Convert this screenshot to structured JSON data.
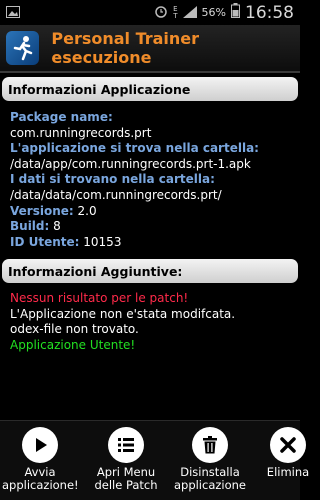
{
  "status_bar": {
    "time": "16:58",
    "battery_percent": "56%",
    "network_label": [
      "E",
      "T"
    ],
    "icons": [
      "image-icon",
      "alarm-icon",
      "network-icon",
      "signal-icon",
      "battery-icon"
    ]
  },
  "app": {
    "title": "Personal Trainer esecuzione",
    "icon": "runner-icon"
  },
  "sections": {
    "app_info": {
      "header": "Informazioni Applicazione",
      "package_label": "Package name:",
      "package_value": "com.runningrecords.prt",
      "location_label": "L'applicazione si trova nella cartella:",
      "location_value": "/data/app/com.runningrecords.prt-1.apk",
      "data_label": "I dati si trovano nella cartella:",
      "data_value": "/data/data/com.runningrecords.prt/",
      "version_label": "Versione:",
      "version_value": "2.0",
      "build_label": "Build:",
      "build_value": "8",
      "uid_label": "ID Utente:",
      "uid_value": "10153"
    },
    "extra_info": {
      "header": "Informazioni Aggiuntive:",
      "patch_result": "Nessun risultato per le patch!",
      "unmodified": "L'Applicazione non e'stata modifcata.",
      "odex": "odex-file non trovato.",
      "user_app": "Applicazione Utente!"
    }
  },
  "actions": [
    {
      "line1": "Avvia",
      "line2": "applicazione!",
      "icon": "play-icon"
    },
    {
      "line1": "Apri Menu",
      "line2": "delle Patch",
      "icon": "list-icon"
    },
    {
      "line1": "Disinstalla",
      "line2": "applicazione",
      "icon": "trash-icon"
    },
    {
      "line1": "Elimina",
      "line2": "",
      "icon": "close-icon"
    }
  ],
  "colors": {
    "title": "#f08c2a",
    "label": "#7aa6de",
    "error": "#ff2a4a",
    "success": "#22e022"
  }
}
